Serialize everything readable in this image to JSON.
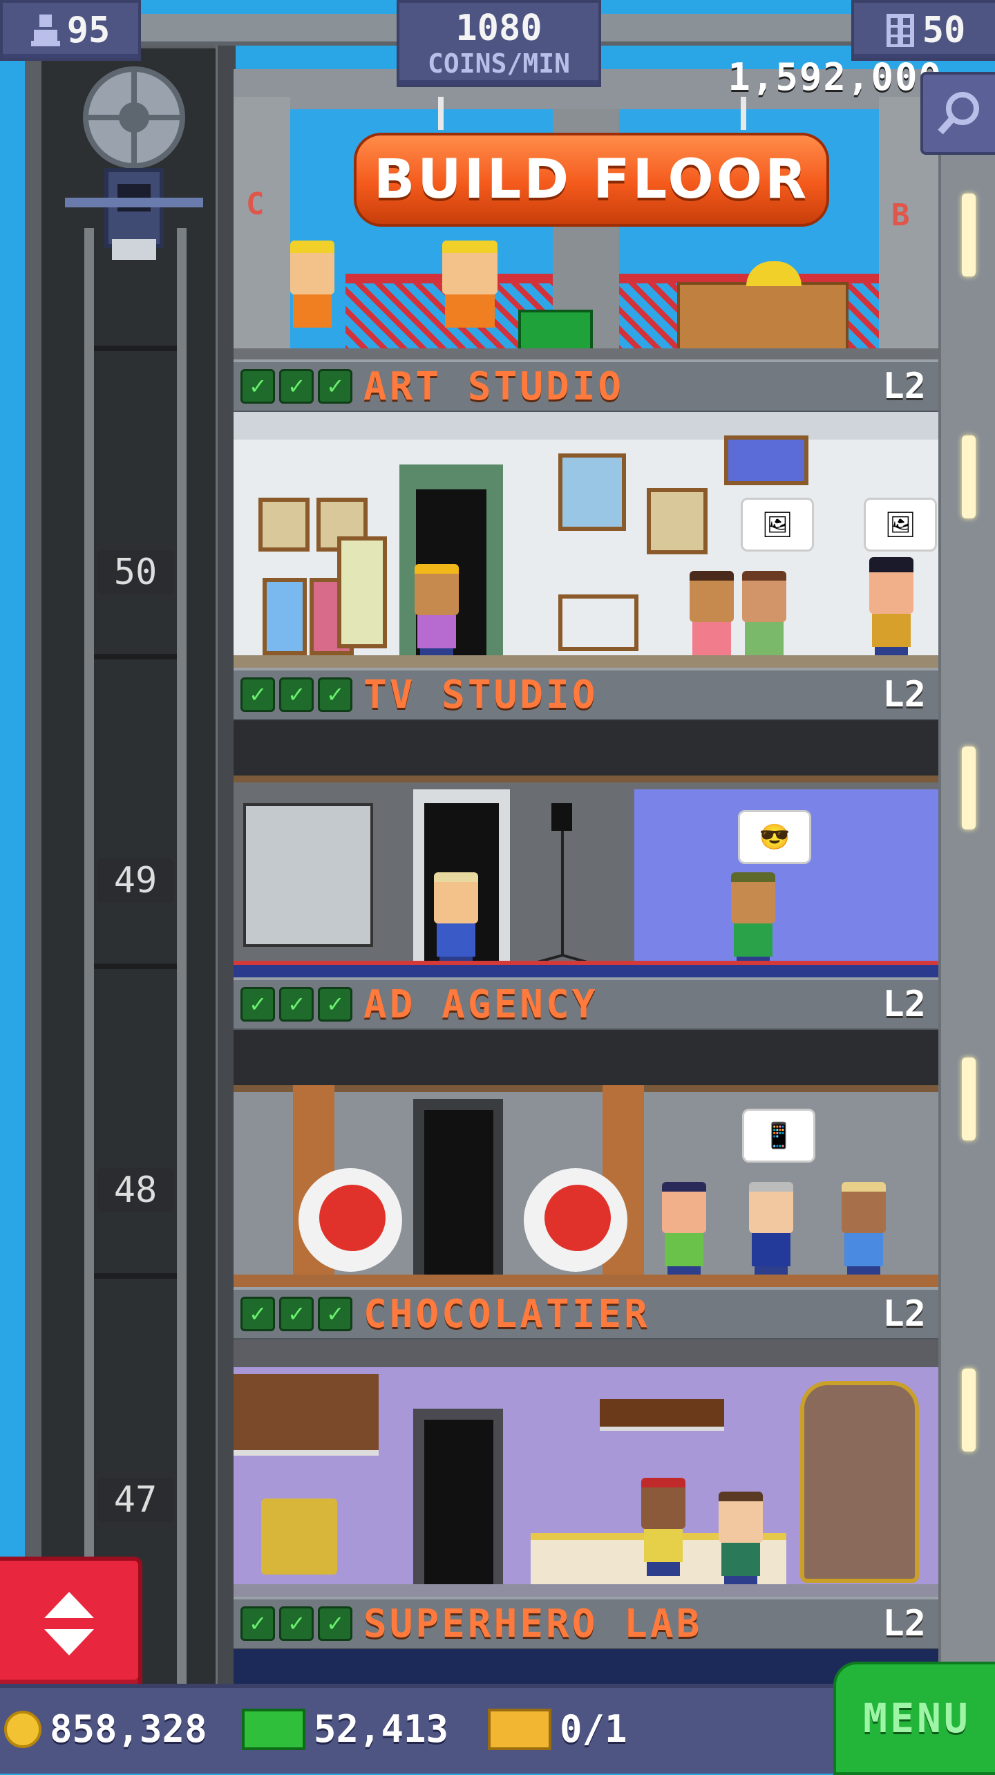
{
  "hud": {
    "population": "95",
    "coins_per_min_value": "1080",
    "coins_per_min_unit": "COINS/MIN",
    "floors": "50",
    "balance": "1,592,000"
  },
  "build": {
    "button_label": "BUILD FLOOR",
    "left_letter": "C",
    "right_letter": "B"
  },
  "shaft_numbers": [
    "50",
    "49",
    "48",
    "47"
  ],
  "floors": [
    {
      "name": "ART STUDIO",
      "level": "L2",
      "checks": 3
    },
    {
      "name": "TV STUDIO",
      "level": "L2",
      "checks": 3
    },
    {
      "name": "AD AGENCY",
      "level": "L2",
      "checks": 3
    },
    {
      "name": "CHOCOLATIER",
      "level": "L2",
      "checks": 3
    },
    {
      "name": "SUPERHERO LAB",
      "level": "L2",
      "checks": 3
    }
  ],
  "bottom": {
    "coins": "858,328",
    "bux": "52,413",
    "tickets": "0/1",
    "menu_label": "MENU"
  },
  "colors": {
    "sky": "#2aa6e6",
    "hud_bg": "#4e5583",
    "floor_name": "#ff7a3c",
    "check_green": "#69f06c",
    "menu_green": "#22b53a",
    "elevator_btn_red": "#e8263e"
  },
  "icons": {
    "population": "person-icon",
    "floors": "building-grid-icon",
    "zoom": "magnifier-icon",
    "elevator_button": "up-down-arrows-icon",
    "coins": "coin-icon",
    "bux": "tower-bux-icon",
    "tickets": "vip-ticket-icon"
  }
}
